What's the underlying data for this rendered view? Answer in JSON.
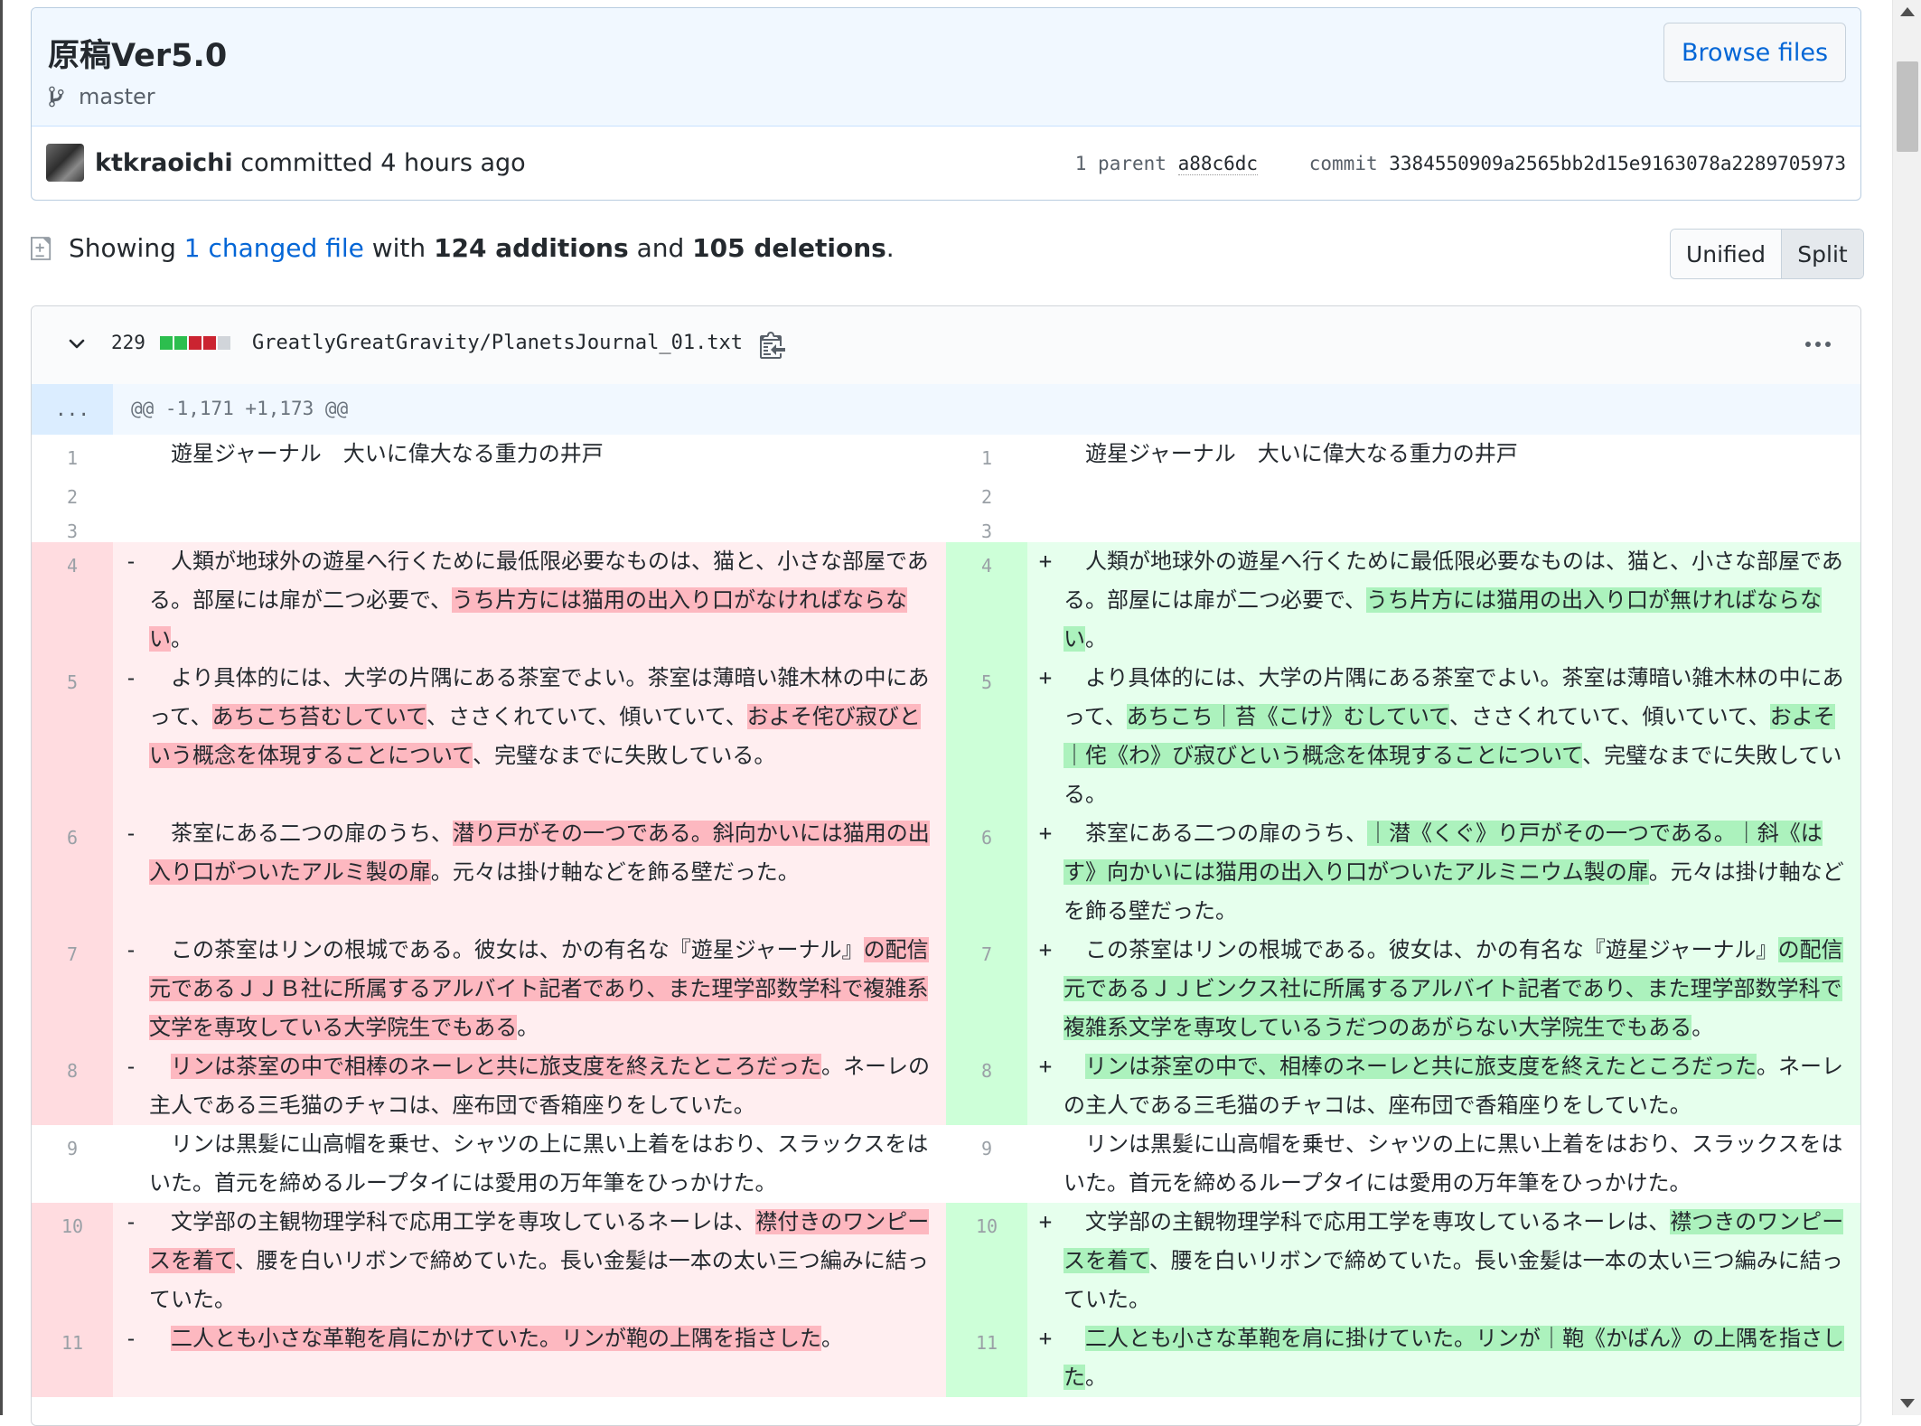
{
  "commit": {
    "title": "原稿Ver5.0",
    "branch": "master",
    "browse_label": "Browse files",
    "author": "ktkraoichi",
    "committed_text": "committed 4 hours ago",
    "parent_label": "1 parent",
    "parent_sha": "a88c6dc",
    "commit_label": "commit",
    "commit_sha": "3384550909a2565bb2d15e9163078a2289705973"
  },
  "summary": {
    "showing": "Showing",
    "changed_files": "1 changed file",
    "with": "with",
    "additions": "124 additions",
    "and": "and",
    "deletions": "105 deletions",
    "period": "."
  },
  "view_toggle": {
    "unified": "Unified",
    "split": "Split",
    "selected": "Split"
  },
  "file": {
    "change_count": "229",
    "diffstat_colors": [
      "#2cbe4e",
      "#2cbe4e",
      "#cb2431",
      "#cb2431",
      "#d1d5da"
    ],
    "path": "GreatlyGreatGravity/PlanetsJournal_01.txt",
    "hunk_expander": "...",
    "hunk_header": "@@ -1,171 +1,173 @@"
  },
  "colors": {
    "del_line": "#ffeef0",
    "del_num": "#ffdce0",
    "del_highlight": "#fdb8c0",
    "add_line": "#e6ffed",
    "add_num": "#cdffd8",
    "add_highlight": "#acf2bd",
    "link": "#0366d6"
  },
  "diff_rows": [
    {
      "type": "ctx",
      "num": "1",
      "left": [
        {
          "t": "　遊星ジャーナル　大いに偉大なる重力の井戸"
        }
      ],
      "right": [
        {
          "t": "　遊星ジャーナル　大いに偉大なる重力の井戸"
        }
      ]
    },
    {
      "type": "ctx",
      "num": "2",
      "left": [
        {
          "t": ""
        }
      ],
      "right": [
        {
          "t": ""
        }
      ]
    },
    {
      "type": "ctx",
      "num": "3",
      "left": [
        {
          "t": ""
        }
      ],
      "right": [
        {
          "t": ""
        }
      ]
    },
    {
      "type": "chg",
      "num": "4",
      "left": [
        {
          "t": "　人類が地球外の遊星へ行くために最低限必要なものは、猫と、小さな部屋である。部屋には扉が二つ必要で、"
        },
        {
          "t": "うち片方には猫用の出入り口がなければならない",
          "h": true
        },
        {
          "t": "。"
        }
      ],
      "right": [
        {
          "t": "　人類が地球外の遊星へ行くために最低限必要なものは、猫と、小さな部屋である。部屋には扉が二つ必要で、"
        },
        {
          "t": "うち片方には猫用の出入り口が無ければならない",
          "h": true
        },
        {
          "t": "。"
        }
      ]
    },
    {
      "type": "chg",
      "num": "5",
      "left": [
        {
          "t": "　より具体的には、大学の片隅にある茶室でよい。茶室は薄暗い雑木林の中にあって、"
        },
        {
          "t": "あちこち苔むしていて",
          "h": true
        },
        {
          "t": "、ささくれていて、傾いていて、"
        },
        {
          "t": "およそ侘び寂びという概念を体現することについて",
          "h": true
        },
        {
          "t": "、完璧なまでに失敗している。\n"
        }
      ],
      "right": [
        {
          "t": "　より具体的には、大学の片隅にある茶室でよい。茶室は薄暗い雑木林の中にあって、"
        },
        {
          "t": "あちこち｜苔《こけ》むしていて",
          "h": true
        },
        {
          "t": "、ささくれていて、傾いていて、"
        },
        {
          "t": "およそ｜侘《わ》び寂びという概念を体現することについて",
          "h": true
        },
        {
          "t": "、完璧なまでに失敗している。"
        }
      ]
    },
    {
      "type": "chg",
      "num": "6",
      "left": [
        {
          "t": "　茶室にある二つの扉のうち、"
        },
        {
          "t": "潜り戸がその一つである。斜向かいには猫用の出入り口がついたアルミ製の扉",
          "h": true
        },
        {
          "t": "。元々は掛け軸などを飾る壁だった。\n"
        }
      ],
      "right": [
        {
          "t": "　茶室にある二つの扉のうち、"
        },
        {
          "t": "｜潜《くぐ》り戸がその一つである。｜斜《はす》向かいには猫用の出入り口がついたアルミニウム製の扉",
          "h": true
        },
        {
          "t": "。元々は掛け軸などを飾る壁だった。"
        }
      ]
    },
    {
      "type": "chg",
      "num": "7",
      "left": [
        {
          "t": "　この茶室はリンの根城である。彼女は、かの有名な『遊星ジャーナル』"
        },
        {
          "t": "の配信元であるＪＪＢ社に所属するアルバイト記者であり、また理学部数学科で複雑系文学を専攻している大学院生でもある",
          "h": true
        },
        {
          "t": "。"
        }
      ],
      "right": [
        {
          "t": "　この茶室はリンの根城である。彼女は、かの有名な『遊星ジャーナル』"
        },
        {
          "t": "の配信元であるＪＪビンクス社に所属するアルバイト記者であり、また理学部数学科で複雑系文学を専攻しているうだつのあがらない大学院生でもある",
          "h": true
        },
        {
          "t": "。"
        }
      ]
    },
    {
      "type": "chg",
      "num": "8",
      "left": [
        {
          "t": "　"
        },
        {
          "t": "リンは茶室の中で相棒のネーレと共に旅支度を終えたところだった",
          "h": true
        },
        {
          "t": "。ネーレの主人である三毛猫のチャコは、座布団で香箱座りをしていた。"
        }
      ],
      "right": [
        {
          "t": "　"
        },
        {
          "t": "リンは茶室の中で、相棒のネーレと共に旅支度を終えたところだった",
          "h": true
        },
        {
          "t": "。ネーレの主人である三毛猫のチャコは、座布団で香箱座りをしていた。"
        }
      ]
    },
    {
      "type": "ctx",
      "num": "9",
      "left": [
        {
          "t": "　リンは黒髪に山高帽を乗せ、シャツの上に黒い上着をはおり、スラックスをはいた。首元を締めるループタイには愛用の万年筆をひっかけた。"
        }
      ],
      "right": [
        {
          "t": "　リンは黒髪に山高帽を乗せ、シャツの上に黒い上着をはおり、スラックスをはいた。首元を締めるループタイには愛用の万年筆をひっかけた。"
        }
      ]
    },
    {
      "type": "chg",
      "num": "10",
      "left": [
        {
          "t": "　文学部の主観物理学科で応用工学を専攻しているネーレは、"
        },
        {
          "t": "襟付きのワンピースを着て",
          "h": true
        },
        {
          "t": "、腰を白いリボンで締めていた。長い金髪は一本の太い三つ編みに結っていた。"
        }
      ],
      "right": [
        {
          "t": "　文学部の主観物理学科で応用工学を専攻しているネーレは、"
        },
        {
          "t": "襟つきのワンピースを着て",
          "h": true
        },
        {
          "t": "、腰を白いリボンで締めていた。長い金髪は一本の太い三つ編みに結っていた。"
        }
      ]
    },
    {
      "type": "chg",
      "num": "11",
      "left": [
        {
          "t": "　"
        },
        {
          "t": "二人とも小さな革鞄を肩にかけていた。リンが鞄の上隅を指さした",
          "h": true
        },
        {
          "t": "。"
        }
      ],
      "right": [
        {
          "t": "　"
        },
        {
          "t": "二人とも小さな革鞄を肩に掛けていた。リンが｜鞄《かばん》の上隅を指さした",
          "h": true
        },
        {
          "t": "。"
        }
      ]
    }
  ]
}
